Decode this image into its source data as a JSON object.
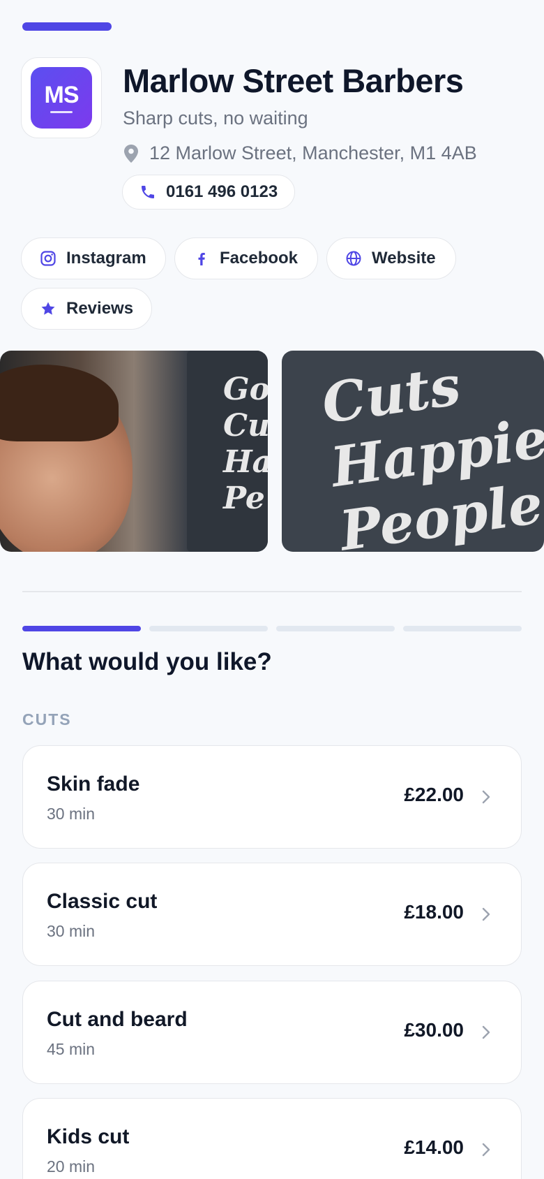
{
  "business": {
    "logo_text": "MS",
    "name": "Marlow Street Barbers",
    "tagline": "Sharp cuts, no waiting",
    "address": "12 Marlow Street, Manchester, M1 4AB",
    "phone": "0161 496 0123"
  },
  "links": [
    {
      "label": "Instagram",
      "icon": "instagram-icon"
    },
    {
      "label": "Facebook",
      "icon": "facebook-icon"
    },
    {
      "label": "Website",
      "icon": "globe-icon"
    },
    {
      "label": "Reviews",
      "icon": "star-icon"
    }
  ],
  "gallery": {
    "photo1_chalk": "Goo Cut Hap Pe",
    "photo2_chalk": "Cuts Happier People"
  },
  "booking": {
    "steps_total": 4,
    "current_step": 1,
    "question": "What would you like?",
    "section": "CUTS",
    "services": [
      {
        "name": "Skin fade",
        "duration": "30 min",
        "price": "£22.00"
      },
      {
        "name": "Classic cut",
        "duration": "30 min",
        "price": "£18.00"
      },
      {
        "name": "Cut and beard",
        "duration": "45 min",
        "price": "£30.00"
      },
      {
        "name": "Kids cut",
        "duration": "20 min",
        "price": "£14.00"
      }
    ]
  },
  "colors": {
    "accent": "#4f46e5",
    "background": "#f7f9fc",
    "text": "#0f172a",
    "muted": "#6b7280"
  }
}
